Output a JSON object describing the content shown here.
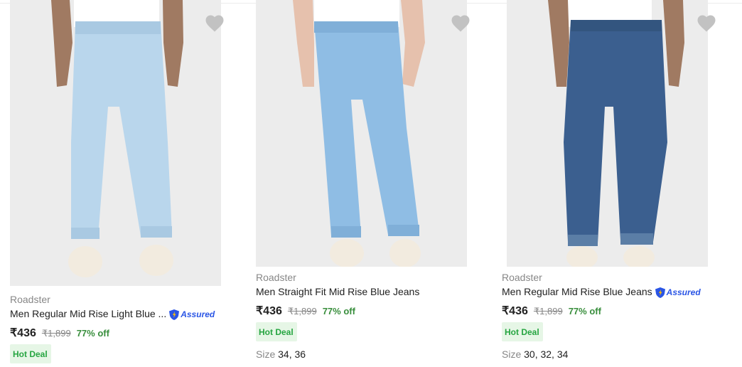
{
  "products": [
    {
      "brand": "Roadster",
      "title": "Men Regular Mid Rise Light Blue ...",
      "assured_label": "Assured",
      "price": "₹436",
      "mrp": "₹1,899",
      "discount": "77% off",
      "deal": "Hot Deal",
      "jeans_color": "#b9d6ec",
      "wishlist_icon": "heart-icon"
    },
    {
      "brand": "Roadster",
      "title": "Men Straight Fit Mid Rise Blue Jeans",
      "price": "₹436",
      "mrp": "₹1,899",
      "discount": "77% off",
      "deal": "Hot Deal",
      "size_label": "Size",
      "sizes": "34, 36",
      "jeans_color": "#8fbde4",
      "wishlist_icon": "heart-icon"
    },
    {
      "brand": "Roadster",
      "title": "Men Regular Mid Rise Blue Jeans",
      "assured_label": "Assured",
      "price": "₹436",
      "mrp": "₹1,899",
      "discount": "77% off",
      "deal": "Hot Deal",
      "size_label": "Size",
      "sizes": "30, 32, 34",
      "jeans_color": "#3b5f8f",
      "wishlist_icon": "heart-icon"
    }
  ],
  "colors": {
    "accent": "#2874f0",
    "discount_green": "#388e3c",
    "deal_bg": "#e6f6e6",
    "assured_blue": "#2a55e5"
  }
}
